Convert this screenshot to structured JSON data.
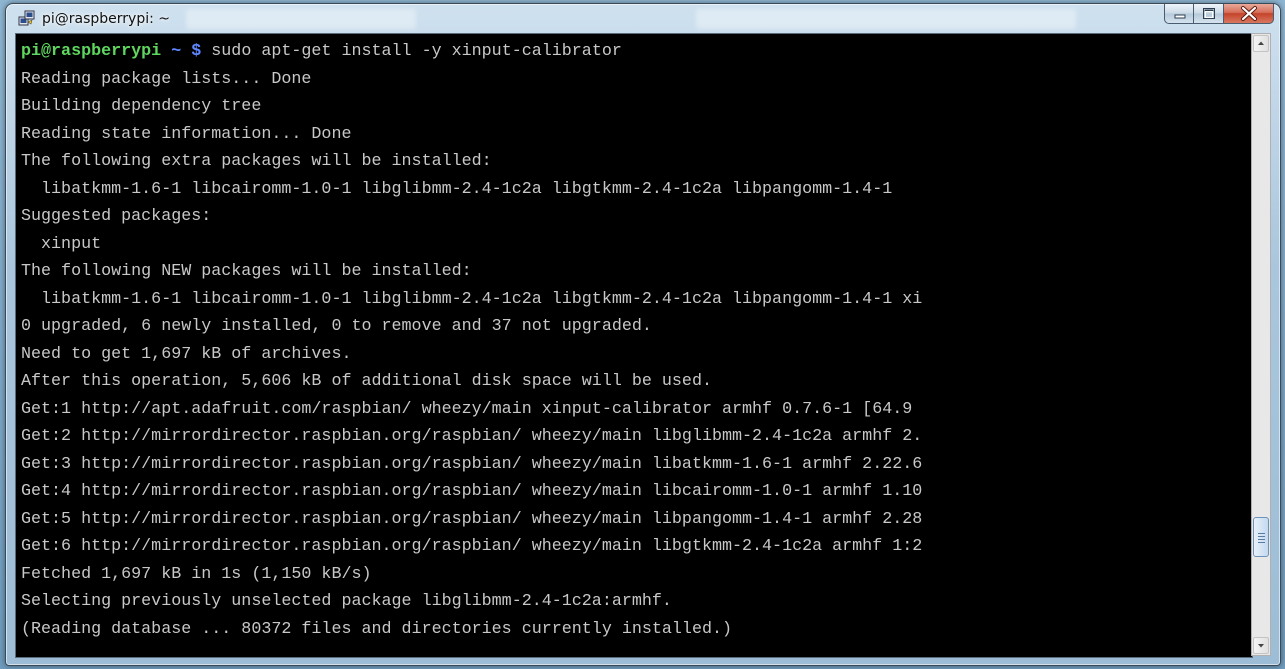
{
  "window": {
    "title": "pi@raspberrypi: ~",
    "app_icon": "putty-icon",
    "controls": {
      "minimize": "minimize-icon",
      "maximize": "maximize-icon",
      "close": "close-icon"
    }
  },
  "prompt": {
    "user_host": "pi@raspberrypi",
    "path": "~",
    "symbol": "$",
    "command": "sudo apt-get install -y xinput-calibrator"
  },
  "output_lines": [
    "Reading package lists... Done",
    "Building dependency tree",
    "Reading state information... Done",
    "The following extra packages will be installed:",
    "  libatkmm-1.6-1 libcairomm-1.0-1 libglibmm-2.4-1c2a libgtkmm-2.4-1c2a libpangomm-1.4-1",
    "Suggested packages:",
    "  xinput",
    "The following NEW packages will be installed:",
    "  libatkmm-1.6-1 libcairomm-1.0-1 libglibmm-2.4-1c2a libgtkmm-2.4-1c2a libpangomm-1.4-1 xi",
    "0 upgraded, 6 newly installed, 0 to remove and 37 not upgraded.",
    "Need to get 1,697 kB of archives.",
    "After this operation, 5,606 kB of additional disk space will be used.",
    "Get:1 http://apt.adafruit.com/raspbian/ wheezy/main xinput-calibrator armhf 0.7.6-1 [64.9",
    "Get:2 http://mirrordirector.raspbian.org/raspbian/ wheezy/main libglibmm-2.4-1c2a armhf 2.",
    "Get:3 http://mirrordirector.raspbian.org/raspbian/ wheezy/main libatkmm-1.6-1 armhf 2.22.6",
    "Get:4 http://mirrordirector.raspbian.org/raspbian/ wheezy/main libcairomm-1.0-1 armhf 1.10",
    "Get:5 http://mirrordirector.raspbian.org/raspbian/ wheezy/main libpangomm-1.4-1 armhf 2.28",
    "Get:6 http://mirrordirector.raspbian.org/raspbian/ wheezy/main libgtkmm-2.4-1c2a armhf 1:2",
    "Fetched 1,697 kB in 1s (1,150 kB/s)",
    "Selecting previously unselected package libglibmm-2.4-1c2a:armhf.",
    "(Reading database ... 80372 files and directories currently installed.)"
  ],
  "colors": {
    "terminal_bg": "#000000",
    "terminal_fg": "#c8c8c8",
    "prompt_user": "#5fd75f",
    "prompt_path": "#5f87ff"
  },
  "scrollbar": {
    "position": 0.85
  }
}
